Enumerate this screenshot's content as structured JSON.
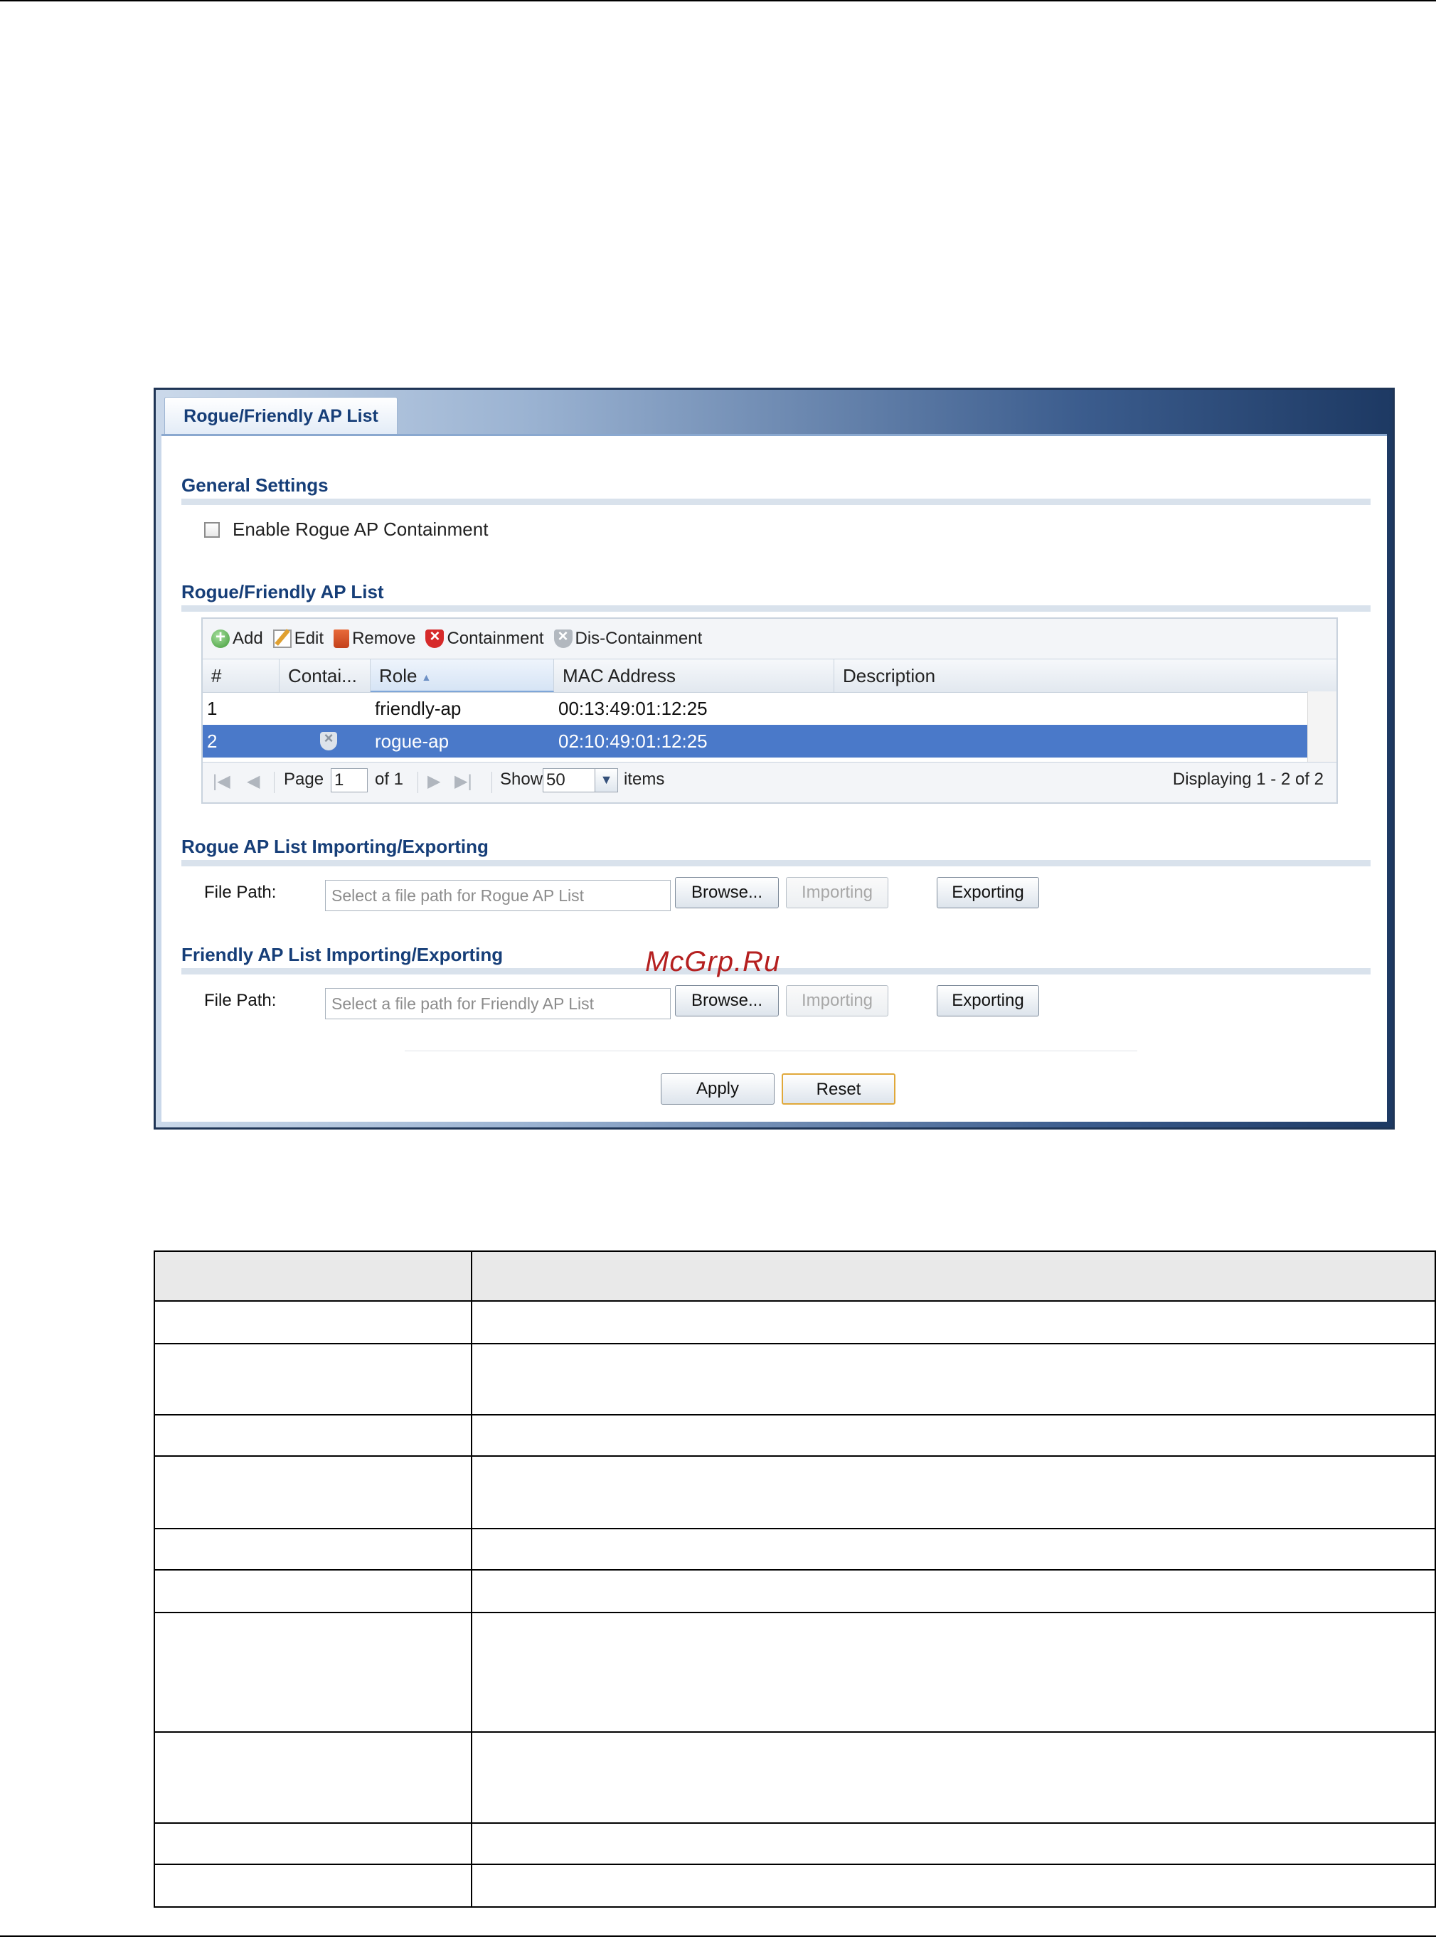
{
  "panel": {
    "tab_title": "Rogue/Friendly AP List",
    "general": {
      "title": "General Settings",
      "enable_containment_label": "Enable Rogue AP Containment",
      "enable_containment_checked": false
    },
    "list": {
      "title": "Rogue/Friendly AP List",
      "toolbar": {
        "add": "Add",
        "edit": "Edit",
        "remove": "Remove",
        "containment": "Containment",
        "dis_containment": "Dis-Containment"
      },
      "columns": {
        "index": "#",
        "containment": "Contai...",
        "role": "Role",
        "mac": "MAC Address",
        "description": "Description"
      },
      "rows": [
        {
          "index": "1",
          "contained": false,
          "role": "friendly-ap",
          "mac": "00:13:49:01:12:25",
          "description": ""
        },
        {
          "index": "2",
          "contained": true,
          "role": "rogue-ap",
          "mac": "02:10:49:01:12:25",
          "description": "",
          "selected": true
        }
      ],
      "pager": {
        "page_label": "Page",
        "page_value": "1",
        "of_label": "of 1",
        "show_label": "Show",
        "show_value": "50",
        "items_label": "items",
        "displaying": "Displaying 1 - 2 of 2"
      }
    },
    "rogue_io": {
      "title": "Rogue AP List Importing/Exporting",
      "file_path_label": "File Path:",
      "placeholder": "Select a file path for Rogue AP List",
      "browse": "Browse...",
      "importing": "Importing",
      "exporting": "Exporting"
    },
    "friendly_io": {
      "title": "Friendly AP List Importing/Exporting",
      "file_path_label": "File Path:",
      "placeholder": "Select a file path for Friendly AP List",
      "browse": "Browse...",
      "importing": "Importing",
      "exporting": "Exporting"
    },
    "apply": "Apply",
    "reset": "Reset"
  },
  "watermark": "McGrp.Ru",
  "colors": {
    "section_title": "#163e78",
    "selected_row": "#4a79c9",
    "panel_border": "#1f3556"
  }
}
